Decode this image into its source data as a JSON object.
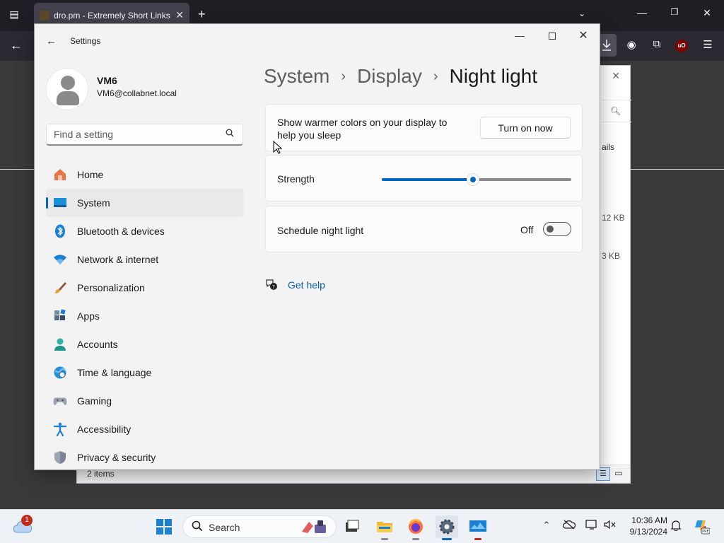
{
  "browser": {
    "tab_title": "dro.pm - Extremely Short Links",
    "tab_close": "✕",
    "new_tab": "+",
    "icons": [
      "tab-list-icon",
      "new-tab-icon",
      "tabs-dropdown-icon",
      "back-icon",
      "download-icon",
      "account-icon",
      "extensions-icon",
      "ublock-icon",
      "menu-icon"
    ],
    "ublock_label": "uO"
  },
  "bg_window": {
    "details_partial": "ails",
    "size1_partial": "12 KB",
    "size2_partial": "3 KB",
    "status": "2 items"
  },
  "settings": {
    "window_title": "Settings",
    "user": {
      "name": "VM6",
      "email": "VM6@collabnet.local"
    },
    "search": {
      "placeholder": "Find a setting"
    },
    "nav": [
      {
        "label": "Home",
        "icon": "home-icon"
      },
      {
        "label": "System",
        "icon": "system-icon",
        "selected": true
      },
      {
        "label": "Bluetooth & devices",
        "icon": "bluetooth-icon"
      },
      {
        "label": "Network & internet",
        "icon": "wifi-icon"
      },
      {
        "label": "Personalization",
        "icon": "brush-icon"
      },
      {
        "label": "Apps",
        "icon": "apps-icon"
      },
      {
        "label": "Accounts",
        "icon": "accounts-icon"
      },
      {
        "label": "Time & language",
        "icon": "globe-icon"
      },
      {
        "label": "Gaming",
        "icon": "gamepad-icon"
      },
      {
        "label": "Accessibility",
        "icon": "accessibility-icon"
      },
      {
        "label": "Privacy & security",
        "icon": "shield-icon"
      }
    ],
    "breadcrumb": [
      "System",
      "Display",
      "Night light"
    ],
    "night_light": {
      "description": "Show warmer colors on your display to help you sleep",
      "turn_on_button": "Turn on now",
      "strength_label": "Strength",
      "strength_value": 0.48,
      "schedule_label": "Schedule night light",
      "schedule_state": "Off",
      "schedule_enabled": false
    },
    "help_link": "Get help"
  },
  "taskbar": {
    "search_placeholder": "Search",
    "notification_count": "1",
    "clock": {
      "time": "10:36 AM",
      "date": "9/13/2024"
    },
    "apps": [
      "start-icon",
      "task-view-icon",
      "file-explorer-icon",
      "firefox-icon",
      "settings-icon",
      "remote-desktop-icon"
    ],
    "tray_icons": [
      "chevron-up-icon",
      "onedrive-icon",
      "display-icon",
      "volume-icon",
      "bell-icon",
      "copilot-icon"
    ]
  },
  "colors": {
    "accent": "#0067c0",
    "link": "#0a5ea8",
    "browser_chrome": "#2b2a33",
    "settings_bg": "#f3f3f3"
  }
}
